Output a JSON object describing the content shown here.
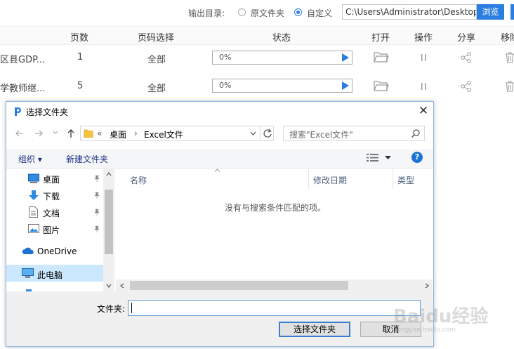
{
  "output": {
    "label": "输出目录:",
    "radio_original": "原文件夹",
    "radio_custom": "自定义",
    "path": "C:\\Users\\Administrator\\Desktop",
    "browse": "浏览"
  },
  "table": {
    "headers": [
      "页数",
      "页码选择",
      "状态",
      "打开",
      "操作",
      "分享",
      "移除"
    ],
    "rows": [
      {
        "name": "区县GDP...",
        "pages": "1",
        "range": "全部",
        "progress": "0%",
        "progress_value": 0
      },
      {
        "name": "学教师继...",
        "pages": "5",
        "range": "全部",
        "progress": "0%",
        "progress_value": 0
      }
    ]
  },
  "dialog": {
    "title": "选择文件夹",
    "breadcrumb": {
      "prefix": "«",
      "item1": "桌面",
      "sep": "›",
      "item2": "Excel文件"
    },
    "search_placeholder": "搜索\"Excel文件\"",
    "organize": "组织 ▾",
    "new_folder": "新建文件夹",
    "help": "?",
    "nav_items": [
      {
        "label": "桌面",
        "icon": "desktop-icon",
        "pinned": true
      },
      {
        "label": "下载",
        "icon": "download-icon",
        "pinned": true
      },
      {
        "label": "文档",
        "icon": "document-icon",
        "pinned": true
      },
      {
        "label": "图片",
        "icon": "picture-icon",
        "pinned": true
      },
      {
        "label": "OneDrive",
        "icon": "cloud-icon",
        "pinned": false
      },
      {
        "label": "此电脑",
        "icon": "computer-icon",
        "pinned": false,
        "selected": true
      }
    ],
    "columns": {
      "name": "名称",
      "date": "修改日期",
      "type": "类型"
    },
    "empty_message": "没有与搜索条件匹配的项。",
    "folder_label": "文件夹:",
    "folder_value": "",
    "select_button": "选择文件夹",
    "cancel_button": "取消"
  },
  "watermark": {
    "brand": "Baidu经验",
    "url": "jingyan.baidu.com"
  },
  "colors": {
    "accent": "#2a7de1",
    "dialog_border": "#8fb5e0",
    "selected_nav": "#cce8ff",
    "help": "#1e73d2"
  }
}
